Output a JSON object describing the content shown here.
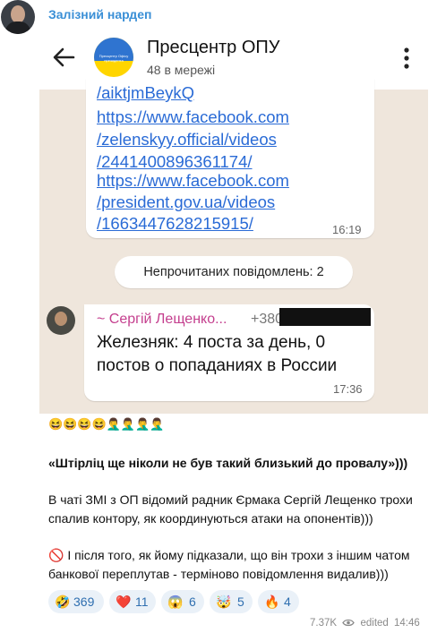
{
  "channel": {
    "name": "Залізний нардеп"
  },
  "screenshot": {
    "group_title": "Пресцентр ОПУ",
    "group_subtitle": "48 в мережі",
    "group_logo_text": "Пресцентр Офісу президента",
    "links": [
      "/aiktjmBeykQ",
      "https://www.facebook.com",
      "/zelenskyy.official/videos",
      "/2441400896361174/",
      "https://www.facebook.com",
      "/president.gov.ua/videos",
      "/1663447628215915/"
    ],
    "message1_time": "16:19",
    "unread_banner": "Непрочитаних повідомлень: 2",
    "sender_name": "~ Сергій Лещенко...",
    "sender_phone": "+380",
    "message2_lines": [
      "Железняк: 4 поста за день, 0",
      "постов о попаданиях в России"
    ],
    "message2_time": "17:36"
  },
  "post": {
    "emoji_line": "😆😆😆😆🤦‍♂️🤦‍♂️🤦‍♂️🤦‍♂️",
    "quote": "«Штірліц ще ніколи не був такий близький до провалу»)))",
    "paragraph1": [
      "В чаті ЗМІ з ОП відомий радник Єрмака Сергій Лещенко трохи",
      "спалив контору, як координуються атаки на опонентів)))"
    ],
    "paragraph2": [
      "🚫 І після того, як йому підказали, що він трохи з іншим чатом",
      "банкової переплутав - терміново повідомлення видалив)))"
    ]
  },
  "reactions": [
    {
      "emoji": "🤣",
      "count": "369"
    },
    {
      "emoji": "❤️",
      "count": "11"
    },
    {
      "emoji": "😱",
      "count": "6"
    },
    {
      "emoji": "🤯",
      "count": "5"
    },
    {
      "emoji": "🔥",
      "count": "4"
    }
  ],
  "footer": {
    "views": "7.37K",
    "edited": "edited",
    "time": "14:46"
  },
  "colors": {
    "channel_name": "#3a8fd6",
    "link": "#2a6bd6",
    "sender": "#c43f8e",
    "chat_bg": "#efe6dc",
    "reaction_bg": "#eaf1f8"
  }
}
